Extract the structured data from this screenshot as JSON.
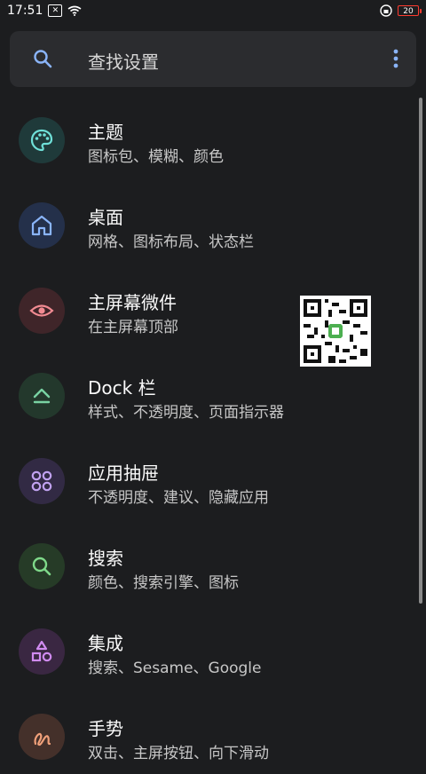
{
  "status_bar": {
    "time": "17:51",
    "battery": "20"
  },
  "search": {
    "placeholder_text": "查找设置"
  },
  "items": [
    {
      "title": "主题",
      "subtitle": "图标包、模糊、颜色"
    },
    {
      "title": "桌面",
      "subtitle": "网格、图标布局、状态栏"
    },
    {
      "title": "主屏幕微件",
      "subtitle": "在主屏幕顶部"
    },
    {
      "title": "Dock 栏",
      "subtitle": "样式、不透明度、页面指示器"
    },
    {
      "title": "应用抽屉",
      "subtitle": "不透明度、建议、隐藏应用"
    },
    {
      "title": "搜索",
      "subtitle": "颜色、搜索引擎、图标"
    },
    {
      "title": "集成",
      "subtitle": "搜索、Sesame、Google"
    },
    {
      "title": "手势",
      "subtitle": "双击、主屏按钮、向下滑动"
    }
  ],
  "colors": {
    "background": "#1c1d1f",
    "search_bg": "#2b2c2f",
    "theme_icon": "#6fe0d8",
    "desktop_icon": "#8ab4f8",
    "widget_icon": "#f28b92",
    "dock_icon": "#79d3a3",
    "drawer_icon": "#c1a2f0",
    "search_icon": "#7fd98a",
    "integration_icon": "#d08bf0",
    "gesture_icon": "#f0a07a"
  }
}
